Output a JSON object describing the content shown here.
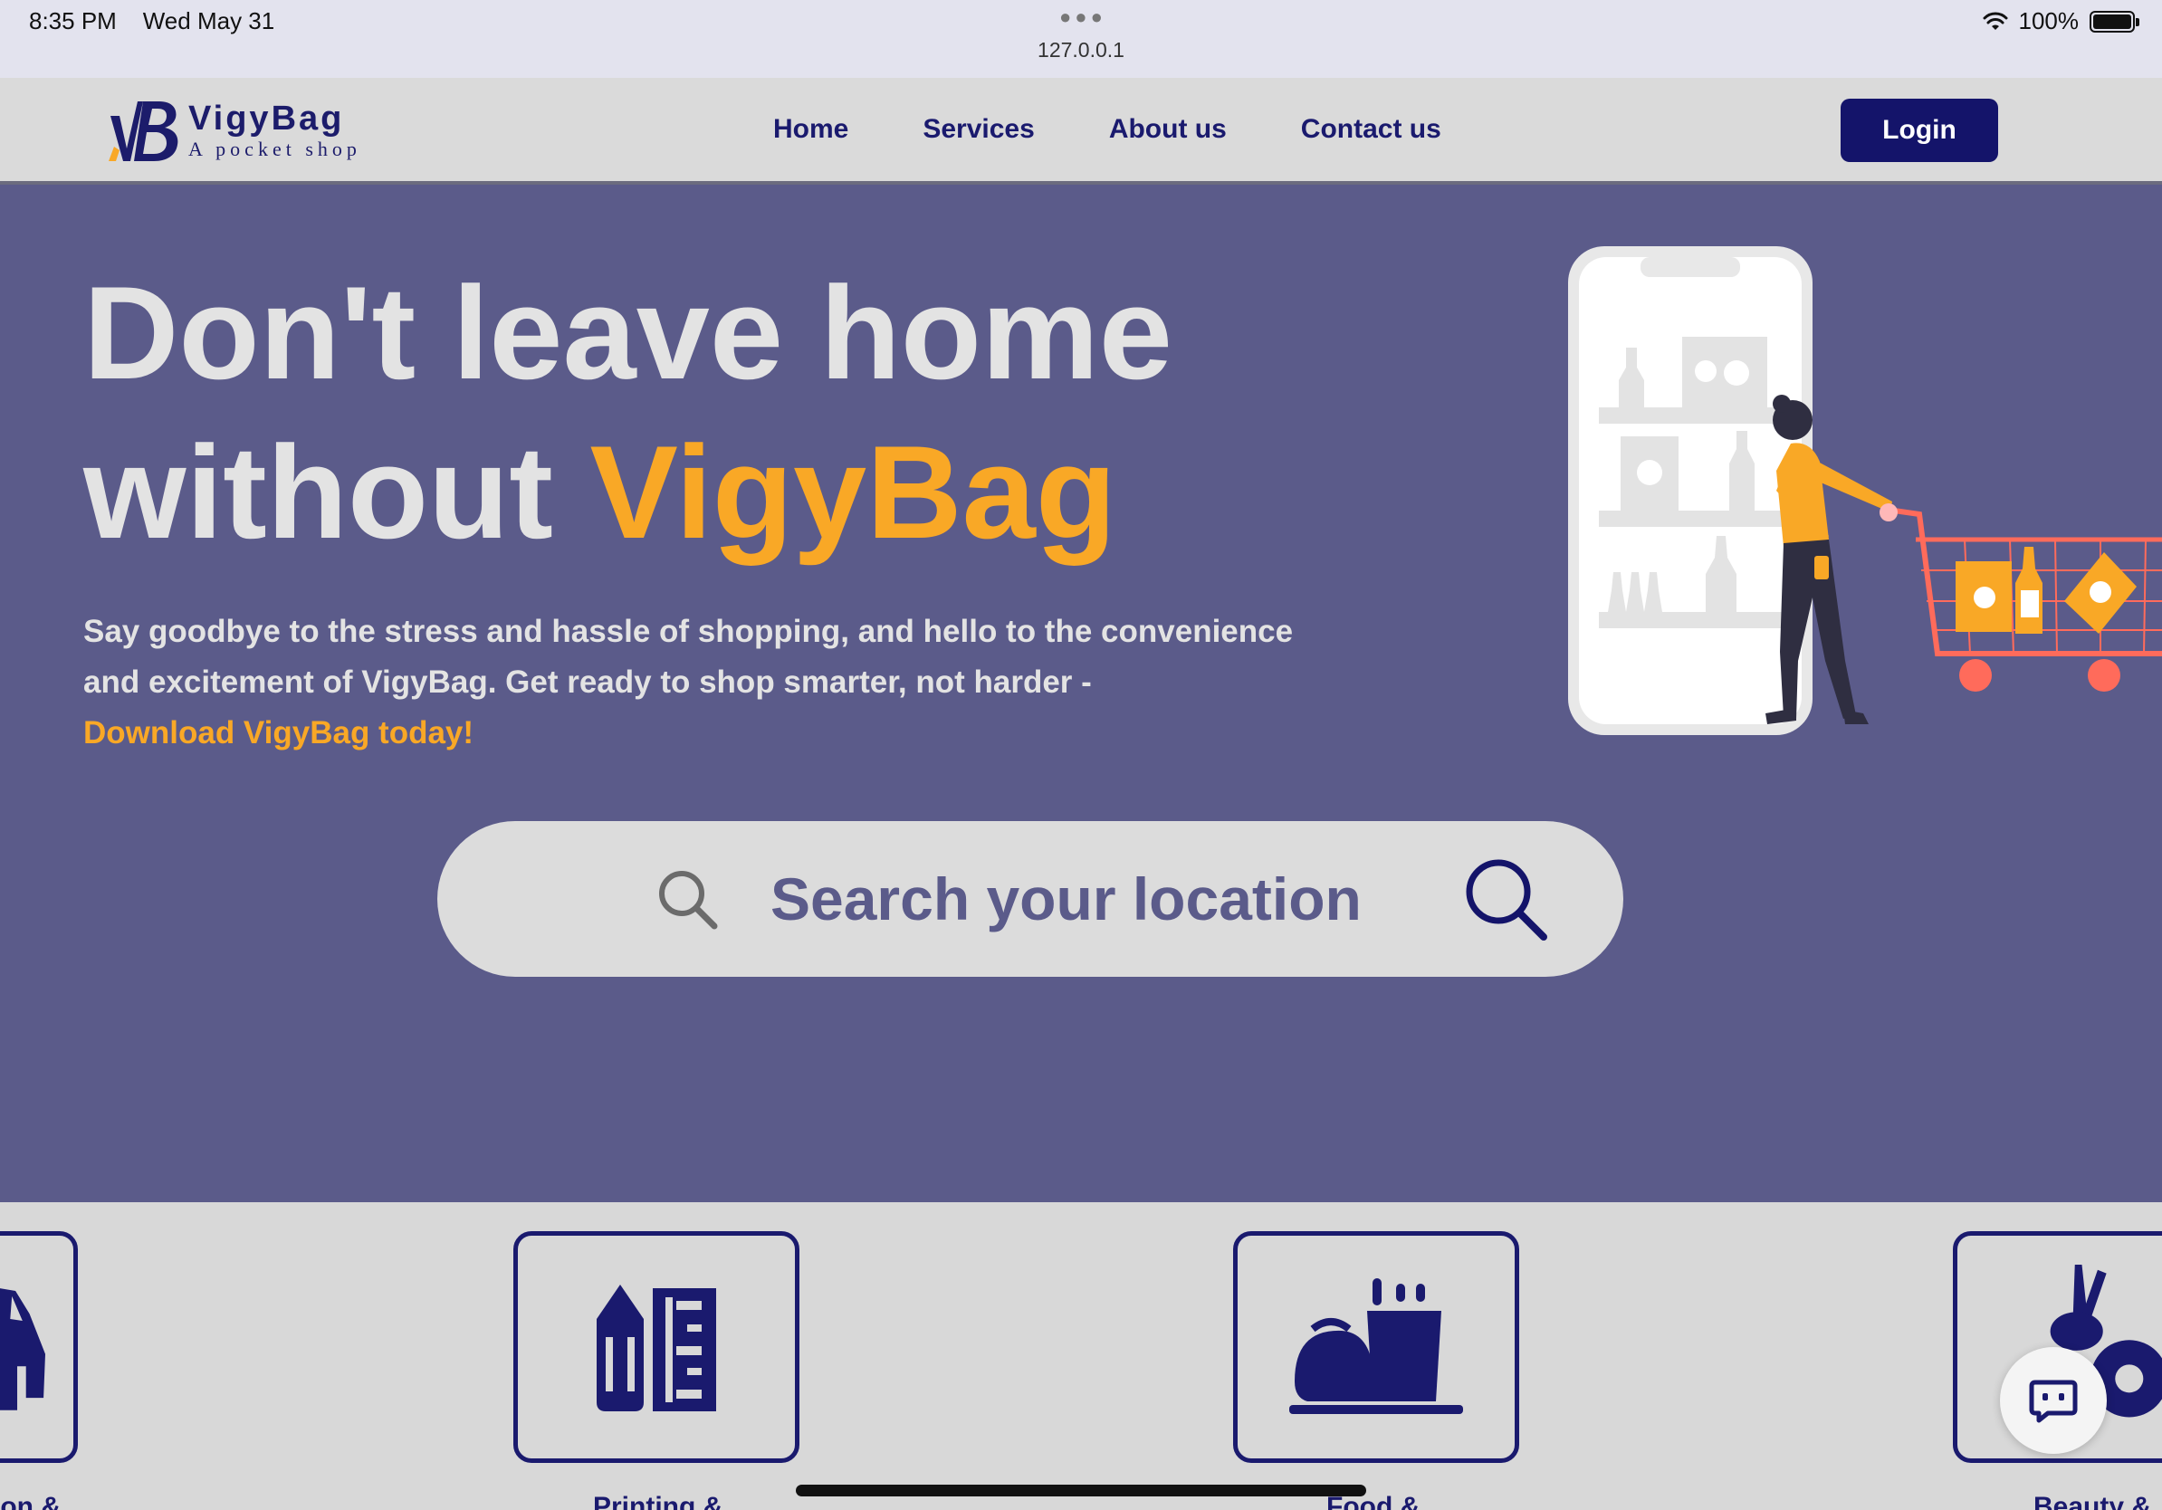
{
  "status_bar": {
    "time": "8:35 PM",
    "date": "Wed May 31",
    "url": "127.0.0.1",
    "battery": "100%",
    "icons": [
      "wifi-icon",
      "battery-icon"
    ]
  },
  "nav": {
    "logo_name": "VigyBag",
    "logo_tagline": "A pocket shop",
    "links": [
      "Home",
      "Services",
      "About us",
      "Contact us"
    ],
    "login_label": "Login"
  },
  "hero": {
    "headline_line1": "Don't leave home",
    "headline_line2_prefix": "without ",
    "headline_line2_accent": "VigyBag",
    "paragraph_line1": "Say goodbye to the stress and hassle of shopping, and hello to the convenience",
    "paragraph_line2": "and excitement of VigyBag. Get ready to shop smarter, not harder -",
    "paragraph_cta": "Download VigyBag today!"
  },
  "search": {
    "placeholder": "Search your location"
  },
  "categories": [
    {
      "label": "ion &",
      "icon": "jacket-icon"
    },
    {
      "label": "Printing &",
      "icon": "stationery-icon"
    },
    {
      "label": "Food &",
      "icon": "food-icon"
    },
    {
      "label": "Beauty &",
      "icon": "beauty-icon"
    }
  ],
  "colors": {
    "hero_bg": "#5b5b8a",
    "accent": "#f9a826",
    "brand_navy": "#1a1a6e",
    "nav_bg": "#dadada"
  }
}
